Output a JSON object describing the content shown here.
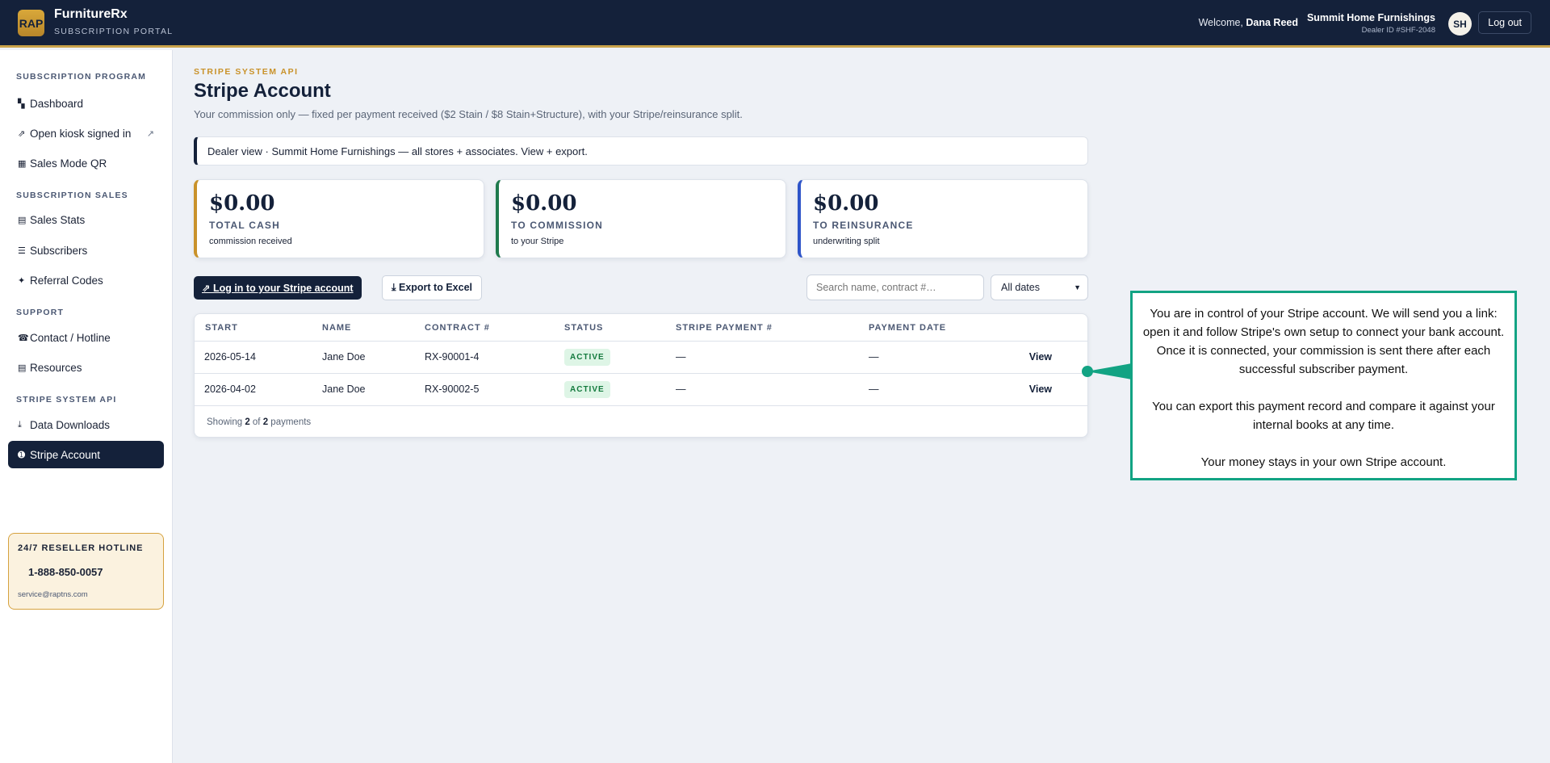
{
  "brand": {
    "logo": "RAP",
    "name": "FurnitureRx",
    "subtitle": "SUBSCRIPTION PORTAL"
  },
  "header": {
    "welcome_prefix": "Welcome, ",
    "user_name": "Dana Reed",
    "dealer_name": "Summit Home Furnishings",
    "dealer_id": "Dealer ID #SHF-2048",
    "avatar_initials": "SH",
    "logout_label": "Log out"
  },
  "sidebar": {
    "sections": {
      "program": "SUBSCRIPTION PROGRAM",
      "sales": "SUBSCRIPTION SALES",
      "support": "SUPPORT",
      "stripe": "STRIPE SYSTEM API"
    },
    "items": [
      {
        "label": "Dashboard",
        "icon": "▚"
      },
      {
        "label": "Open kiosk signed in",
        "icon": "⇗",
        "external": "↗"
      },
      {
        "label": "Sales Mode QR",
        "icon": "▦"
      },
      {
        "label": "Sales Stats",
        "icon": "▤"
      },
      {
        "label": "Subscribers",
        "icon": "☰"
      },
      {
        "label": "Referral Codes",
        "icon": "✦"
      },
      {
        "label": "Contact / Hotline",
        "icon": "☎"
      },
      {
        "label": "Resources",
        "icon": "▤"
      },
      {
        "label": "Data Downloads",
        "icon": "⤓"
      },
      {
        "label": "Stripe Account",
        "icon": "➊"
      }
    ],
    "hotline": {
      "title": "24/7 RESELLER HOTLINE",
      "phone": "1-888-850-0057",
      "email": "service@raptns.com"
    }
  },
  "main": {
    "eyebrow": "STRIPE SYSTEM API",
    "title": "Stripe Account",
    "description": "Your commission only — fixed per payment received ($2 Stain / $8 Stain+Structure), with your Stripe/reinsurance split.",
    "notice": "Dealer view · Summit Home Furnishings — all stores + associates. View + export.",
    "stats": [
      {
        "amount": "$0.00",
        "label": "TOTAL CASH",
        "sub": "commission received",
        "accent": "#c9922a"
      },
      {
        "amount": "$0.00",
        "label": "TO COMMISSION",
        "sub": "to your Stripe",
        "accent": "#1f7a4d"
      },
      {
        "amount": "$0.00",
        "label": "TO REINSURANCE",
        "sub": "underwriting split",
        "accent": "#2f55c9"
      }
    ],
    "actions": {
      "stripe_login": "⇗ Log in to your Stripe account",
      "export": "⤓ Export to Excel",
      "search_placeholder": "Search name, contract #…",
      "date_filter": "All dates"
    },
    "table": {
      "headers": [
        "START",
        "NAME",
        "CONTRACT #",
        "STATUS",
        "STRIPE PAYMENT #",
        "PAYMENT DATE"
      ],
      "rows": [
        {
          "start": "2026-05-14",
          "name": "Jane Doe",
          "contract": "RX-90001-4",
          "status": "ACTIVE",
          "payment": "—",
          "date": "—",
          "action": "View"
        },
        {
          "start": "2026-04-02",
          "name": "Jane Doe",
          "contract": "RX-90002-5",
          "status": "ACTIVE",
          "payment": "—",
          "date": "—",
          "action": "View"
        }
      ],
      "footer": {
        "prefix": "Showing ",
        "shown": "2",
        "middle": " of ",
        "total": "2",
        "suffix": " payments"
      }
    }
  },
  "callout": {
    "paragraphs": [
      "You are in control of your Stripe account. We will send you a link: open it and follow Stripe's own setup to connect your bank account. Once it is connected, your commission is sent there after each successful subscriber payment.",
      "You can export this payment record and compare it against your internal books at any time.",
      "Your money stays in your own Stripe account."
    ],
    "color": "#12a383"
  }
}
